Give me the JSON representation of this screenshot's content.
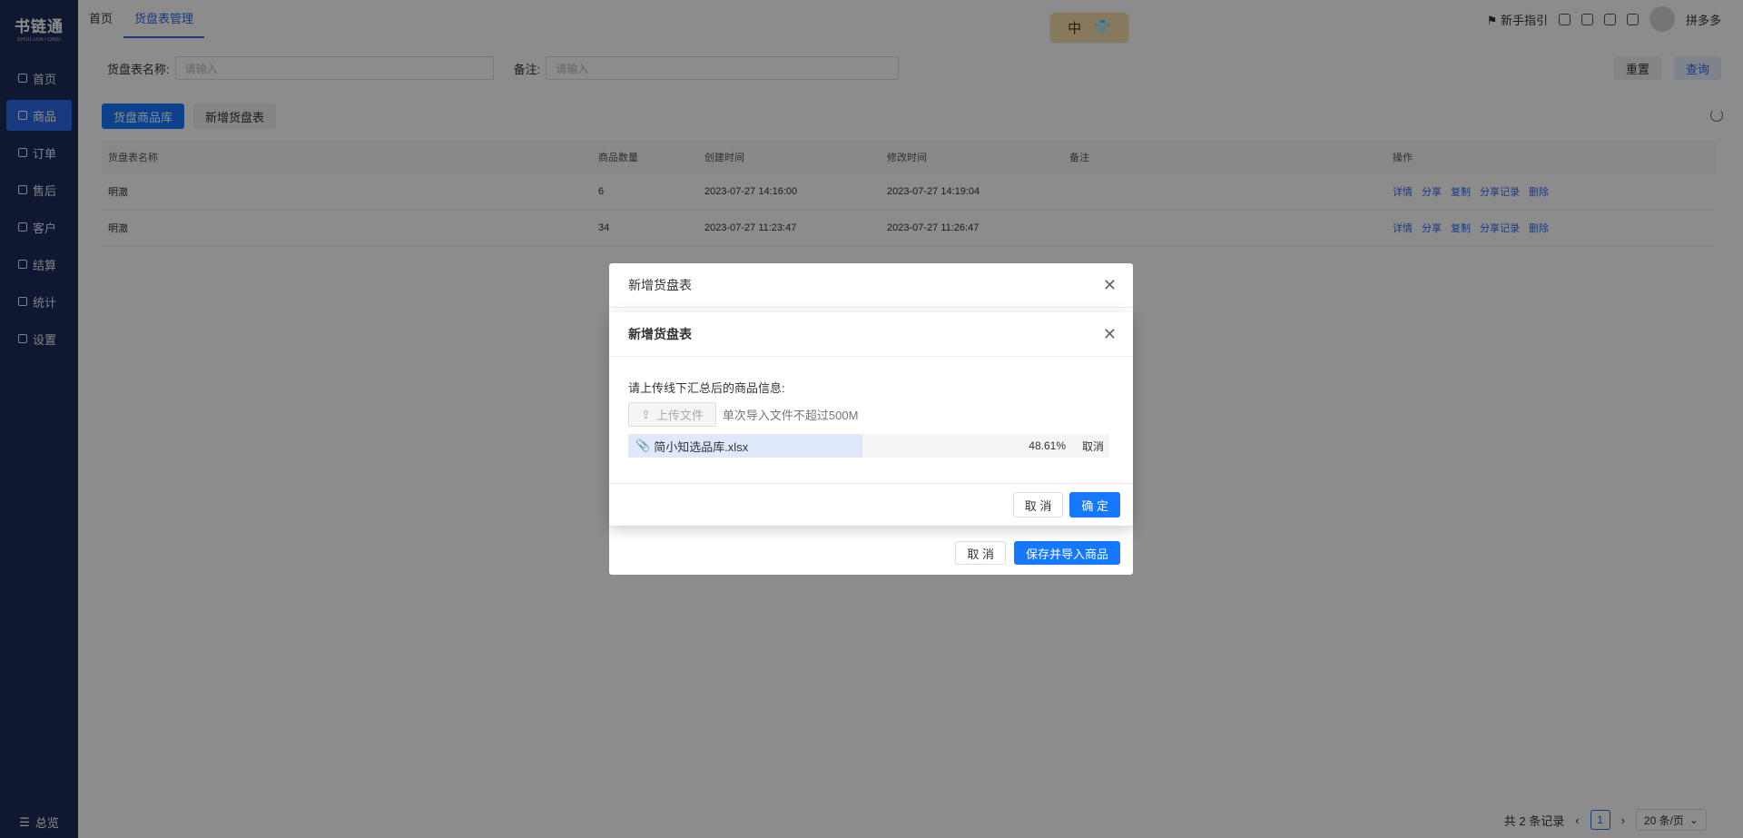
{
  "sidebar": {
    "brand": "书链通",
    "brand_sub": "SHULIANTONG",
    "items": [
      {
        "label": "首页",
        "icon": "monitor-icon"
      },
      {
        "label": "商品",
        "icon": "box-icon",
        "active": true
      },
      {
        "label": "订单",
        "icon": "document-icon"
      },
      {
        "label": "售后",
        "icon": "headset-icon"
      },
      {
        "label": "客户",
        "icon": "user-icon"
      },
      {
        "label": "结算",
        "icon": "coin-icon"
      },
      {
        "label": "统计",
        "icon": "clock-icon"
      },
      {
        "label": "设置",
        "icon": "settings-icon"
      }
    ],
    "footer": "总览"
  },
  "topbar": {
    "tabs": [
      "首页",
      "货盘表管理"
    ],
    "active_tab": "货盘表管理",
    "guide": "新手指引",
    "user": "拼多多",
    "ime_text": "中"
  },
  "search": {
    "name_label": "货盘表名称:",
    "name_placeholder": "请输入",
    "remark_label": "备注:",
    "remark_placeholder": "请输入",
    "reset": "重置",
    "query": "查询"
  },
  "tabs_btns": {
    "library": "货盘商品库",
    "add": "新增货盘表"
  },
  "table": {
    "headers": [
      "货盘表名称",
      "商品数量",
      "创建时间",
      "修改时间",
      "备注",
      "操作"
    ],
    "rows": [
      {
        "name": "明澈",
        "count": "6",
        "created": "2023-07-27 14:16:00",
        "modified": "2023-07-27 14:19:04",
        "remark": ""
      },
      {
        "name": "明澈",
        "count": "34",
        "created": "2023-07-27 11:23:47",
        "modified": "2023-07-27 11:26:47",
        "remark": ""
      }
    ],
    "ops": [
      "详情",
      "分享",
      "复制",
      "分享记录",
      "删除"
    ]
  },
  "pager": {
    "total": "共 2 条记录",
    "page": "1",
    "size": "20 条/页"
  },
  "dialog_back": {
    "title": "新增货盘表",
    "cancel": "取 消",
    "save": "保存并导入商品"
  },
  "dialog_front": {
    "title": "新增货盘表",
    "upload_label": "请上传线下汇总后的商品信息:",
    "upload_btn": "上传文件",
    "upload_hint": "单次导入文件不超过500M",
    "file_name": "简小知选品库.xlsx",
    "file_pct": "48.61%",
    "file_progress": 0.4861,
    "file_cancel": "取消",
    "cancel": "取 消",
    "ok": "确 定"
  },
  "colors": {
    "sidebar_bg": "#1c2b5a",
    "accent": "#1677ff"
  }
}
